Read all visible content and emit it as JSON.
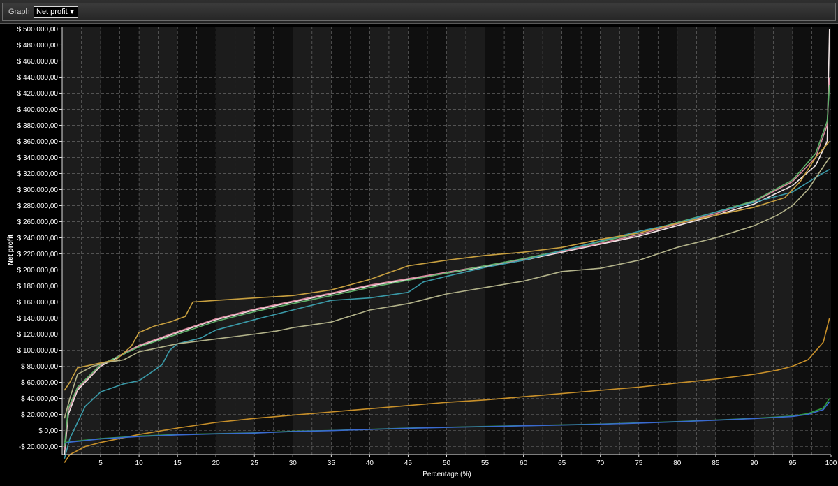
{
  "toolbar": {
    "label": "Graph",
    "selected_graph": "Net profit"
  },
  "colors": {
    "plot_background": "#0a0a0a",
    "band_light": "#2b2b2b",
    "band_dark": "#141414",
    "grid": "#9a9a9a",
    "text": "#ffffff",
    "axis": "#e0e0e0"
  },
  "chart_data": {
    "type": "line",
    "title": "",
    "xlabel": "Percentage (%)",
    "ylabel": "Net profit",
    "xlim": [
      0,
      100
    ],
    "ylim": [
      -30000,
      500000
    ],
    "x_ticks": [
      5,
      10,
      15,
      20,
      25,
      30,
      35,
      40,
      45,
      50,
      55,
      60,
      65,
      70,
      75,
      80,
      85,
      90,
      95,
      100
    ],
    "y_ticks": [
      -20000,
      0,
      20000,
      40000,
      60000,
      80000,
      100000,
      120000,
      140000,
      160000,
      180000,
      200000,
      220000,
      240000,
      260000,
      280000,
      300000,
      320000,
      340000,
      360000,
      380000,
      400000,
      420000,
      440000,
      460000,
      480000,
      500000
    ],
    "y_tick_labels": [
      "-$ 20.000,00",
      "$ 0,00",
      "$ 20.000,00",
      "$ 40.000,00",
      "$ 60.000,00",
      "$ 80.000,00",
      "$ 100.000,00",
      "$ 120.000,00",
      "$ 140.000,00",
      "$ 160.000,00",
      "$ 180.000,00",
      "$ 200.000,00",
      "$ 220.000,00",
      "$ 240.000,00",
      "$ 260.000,00",
      "$ 280.000,00",
      "$ 300.000,00",
      "$ 320.000,00",
      "$ 340.000,00",
      "$ 360.000,00",
      "$ 380.000,00",
      "$ 400.000,00",
      "$ 420.000,00",
      "$ 440.000,00",
      "$ 460.000,00",
      "$ 480.000,00",
      "$ 500.000,00"
    ],
    "grid": true,
    "legend": "none",
    "series": [
      {
        "color": "#f2e6e6",
        "points": [
          [
            0.3,
            -30000
          ],
          [
            0.8,
            20000
          ],
          [
            2,
            50000
          ],
          [
            5,
            80000
          ],
          [
            10,
            105000
          ],
          [
            15,
            122000
          ],
          [
            20,
            138000
          ],
          [
            25,
            150000
          ],
          [
            30,
            160000
          ],
          [
            35,
            170000
          ],
          [
            40,
            180000
          ],
          [
            45,
            188000
          ],
          [
            50,
            196000
          ],
          [
            55,
            204000
          ],
          [
            60,
            212000
          ],
          [
            65,
            222000
          ],
          [
            70,
            232000
          ],
          [
            75,
            242000
          ],
          [
            80,
            255000
          ],
          [
            85,
            268000
          ],
          [
            90,
            282000
          ],
          [
            95,
            305000
          ],
          [
            98,
            330000
          ],
          [
            99.5,
            360000
          ],
          [
            99.8,
            500000
          ]
        ]
      },
      {
        "color": "#d98aa0",
        "points": [
          [
            0.3,
            -25000
          ],
          [
            0.8,
            25000
          ],
          [
            2,
            52000
          ],
          [
            5,
            81000
          ],
          [
            10,
            106000
          ],
          [
            15,
            123000
          ],
          [
            20,
            139000
          ],
          [
            25,
            151000
          ],
          [
            30,
            161000
          ],
          [
            35,
            171000
          ],
          [
            40,
            181000
          ],
          [
            45,
            189000
          ],
          [
            50,
            197000
          ],
          [
            55,
            205000
          ],
          [
            60,
            213000
          ],
          [
            65,
            223000
          ],
          [
            70,
            233000
          ],
          [
            75,
            244000
          ],
          [
            80,
            257000
          ],
          [
            85,
            270000
          ],
          [
            90,
            285000
          ],
          [
            95,
            310000
          ],
          [
            98,
            340000
          ],
          [
            99.5,
            380000
          ],
          [
            99.8,
            440000
          ]
        ]
      },
      {
        "color": "#5fb06a",
        "points": [
          [
            0.3,
            -20000
          ],
          [
            0.8,
            28000
          ],
          [
            2,
            54000
          ],
          [
            5,
            82000
          ],
          [
            10,
            104000
          ],
          [
            15,
            120000
          ],
          [
            20,
            136000
          ],
          [
            25,
            148000
          ],
          [
            30,
            158000
          ],
          [
            35,
            168000
          ],
          [
            40,
            178000
          ],
          [
            45,
            187000
          ],
          [
            50,
            196000
          ],
          [
            55,
            205000
          ],
          [
            60,
            214000
          ],
          [
            65,
            224000
          ],
          [
            70,
            235000
          ],
          [
            75,
            246000
          ],
          [
            80,
            259000
          ],
          [
            85,
            272000
          ],
          [
            90,
            286000
          ],
          [
            95,
            312000
          ],
          [
            98,
            345000
          ],
          [
            99.5,
            385000
          ],
          [
            99.8,
            430000
          ]
        ]
      },
      {
        "color": "#3a9aa8",
        "points": [
          [
            0.3,
            -35000
          ],
          [
            1,
            -10000
          ],
          [
            3,
            30000
          ],
          [
            5,
            48000
          ],
          [
            8,
            58000
          ],
          [
            10,
            62000
          ],
          [
            12,
            75000
          ],
          [
            13,
            82000
          ],
          [
            14,
            100000
          ],
          [
            15,
            108000
          ],
          [
            18,
            115000
          ],
          [
            20,
            125000
          ],
          [
            25,
            138000
          ],
          [
            30,
            150000
          ],
          [
            35,
            162000
          ],
          [
            40,
            165000
          ],
          [
            45,
            172000
          ],
          [
            47,
            185000
          ],
          [
            50,
            192000
          ],
          [
            55,
            203000
          ],
          [
            60,
            212000
          ],
          [
            65,
            224000
          ],
          [
            70,
            236000
          ],
          [
            75,
            248000
          ],
          [
            80,
            258000
          ],
          [
            85,
            272000
          ],
          [
            90,
            284000
          ],
          [
            95,
            297000
          ],
          [
            98,
            315000
          ],
          [
            99.8,
            325000
          ]
        ]
      },
      {
        "color": "#c8a040",
        "points": [
          [
            0.3,
            50000
          ],
          [
            1,
            60000
          ],
          [
            2,
            78000
          ],
          [
            4,
            82000
          ],
          [
            7,
            88000
          ],
          [
            9,
            105000
          ],
          [
            10,
            122000
          ],
          [
            12,
            130000
          ],
          [
            14,
            135000
          ],
          [
            16,
            142000
          ],
          [
            17,
            160000
          ],
          [
            20,
            162000
          ],
          [
            25,
            165000
          ],
          [
            30,
            168000
          ],
          [
            35,
            175000
          ],
          [
            40,
            188000
          ],
          [
            45,
            205000
          ],
          [
            50,
            212000
          ],
          [
            55,
            218000
          ],
          [
            60,
            222000
          ],
          [
            65,
            228000
          ],
          [
            70,
            238000
          ],
          [
            75,
            246000
          ],
          [
            80,
            258000
          ],
          [
            85,
            268000
          ],
          [
            90,
            278000
          ],
          [
            94,
            290000
          ],
          [
            96,
            310000
          ],
          [
            98,
            340000
          ],
          [
            99.8,
            360000
          ]
        ]
      },
      {
        "color": "#b3b38a",
        "points": [
          [
            0.3,
            15000
          ],
          [
            1,
            40000
          ],
          [
            2,
            70000
          ],
          [
            4,
            80000
          ],
          [
            6,
            85000
          ],
          [
            8,
            88000
          ],
          [
            10,
            98000
          ],
          [
            15,
            108000
          ],
          [
            20,
            114000
          ],
          [
            25,
            120000
          ],
          [
            28,
            124000
          ],
          [
            30,
            128000
          ],
          [
            35,
            135000
          ],
          [
            40,
            150000
          ],
          [
            45,
            158000
          ],
          [
            50,
            170000
          ],
          [
            55,
            178000
          ],
          [
            60,
            186000
          ],
          [
            65,
            198000
          ],
          [
            70,
            202000
          ],
          [
            75,
            212000
          ],
          [
            80,
            228000
          ],
          [
            85,
            240000
          ],
          [
            90,
            255000
          ],
          [
            93,
            268000
          ],
          [
            95,
            280000
          ],
          [
            97,
            300000
          ],
          [
            99.8,
            340000
          ]
        ]
      },
      {
        "color": "#c8902a",
        "points": [
          [
            0.3,
            -40000
          ],
          [
            1,
            -30000
          ],
          [
            3,
            -20000
          ],
          [
            5,
            -15000
          ],
          [
            10,
            -5000
          ],
          [
            15,
            3000
          ],
          [
            20,
            10000
          ],
          [
            25,
            15000
          ],
          [
            30,
            19000
          ],
          [
            35,
            23000
          ],
          [
            40,
            27000
          ],
          [
            45,
            31000
          ],
          [
            50,
            35000
          ],
          [
            55,
            38000
          ],
          [
            60,
            42000
          ],
          [
            65,
            46000
          ],
          [
            70,
            50000
          ],
          [
            75,
            54000
          ],
          [
            80,
            59000
          ],
          [
            85,
            64000
          ],
          [
            90,
            70000
          ],
          [
            93,
            75000
          ],
          [
            95,
            80000
          ],
          [
            97,
            88000
          ],
          [
            99,
            110000
          ],
          [
            99.8,
            140000
          ]
        ]
      },
      {
        "color": "#2e9e3a",
        "points": [
          [
            0.3,
            -15000
          ],
          [
            1,
            -14000
          ],
          [
            3,
            -12000
          ],
          [
            5,
            -10000
          ],
          [
            10,
            -7000
          ],
          [
            15,
            -5000
          ],
          [
            20,
            -4000
          ],
          [
            25,
            -3000
          ],
          [
            30,
            -1000
          ],
          [
            35,
            0
          ],
          [
            40,
            1500
          ],
          [
            45,
            3000
          ],
          [
            50,
            4000
          ],
          [
            55,
            5000
          ],
          [
            60,
            6000
          ],
          [
            65,
            7000
          ],
          [
            70,
            8000
          ],
          [
            75,
            9500
          ],
          [
            80,
            11000
          ],
          [
            85,
            13000
          ],
          [
            90,
            15000
          ],
          [
            95,
            18000
          ],
          [
            97,
            21000
          ],
          [
            99,
            28000
          ],
          [
            99.8,
            40000
          ]
        ]
      },
      {
        "color": "#3a6ad0",
        "points": [
          [
            0.3,
            -16000
          ],
          [
            1,
            -14500
          ],
          [
            3,
            -12500
          ],
          [
            5,
            -10500
          ],
          [
            10,
            -7500
          ],
          [
            15,
            -5500
          ],
          [
            20,
            -4200
          ],
          [
            25,
            -3200
          ],
          [
            30,
            -1200
          ],
          [
            35,
            -200
          ],
          [
            40,
            1300
          ],
          [
            45,
            2800
          ],
          [
            50,
            3800
          ],
          [
            55,
            4800
          ],
          [
            60,
            5800
          ],
          [
            65,
            6800
          ],
          [
            70,
            7800
          ],
          [
            75,
            9200
          ],
          [
            80,
            10800
          ],
          [
            85,
            12800
          ],
          [
            90,
            14800
          ],
          [
            95,
            17500
          ],
          [
            97,
            20000
          ],
          [
            99,
            26000
          ],
          [
            99.8,
            36000
          ]
        ]
      }
    ]
  }
}
